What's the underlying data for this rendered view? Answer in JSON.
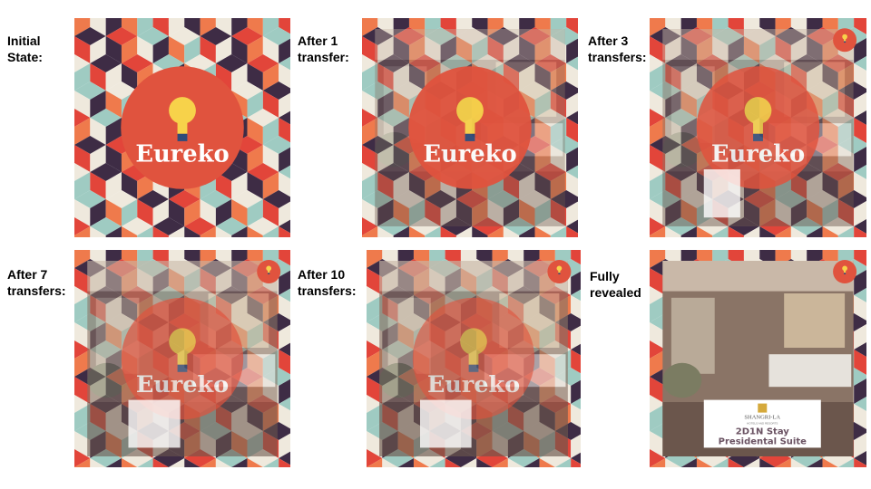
{
  "colors": {
    "dark": "#3e2c45",
    "red": "#e2453a",
    "orange": "#ef7a4c",
    "cream": "#efe9dd",
    "teal": "#9fcbc2",
    "logo": "#e0533e",
    "bulb": "#f7d24a"
  },
  "logo_text": "Eureko",
  "card": {
    "brand": "SHANGRI-LA",
    "brand_sub": "HOTELS AND RESORTS",
    "line1": "2D1N Stay",
    "line2": "Presidental Suite"
  },
  "panels": [
    {
      "label": "Initial\nState:",
      "reveal": 0
    },
    {
      "label": "After 1\ntransfer:",
      "reveal": 0.1
    },
    {
      "label": "After 3\ntransfers:",
      "reveal": 0.3
    },
    {
      "label": "After 7\ntransfers:",
      "reveal": 0.6
    },
    {
      "label": "After 10\ntransfers:",
      "reveal": 0.75
    },
    {
      "label": "Fully\nrevealed",
      "reveal": 1
    }
  ]
}
